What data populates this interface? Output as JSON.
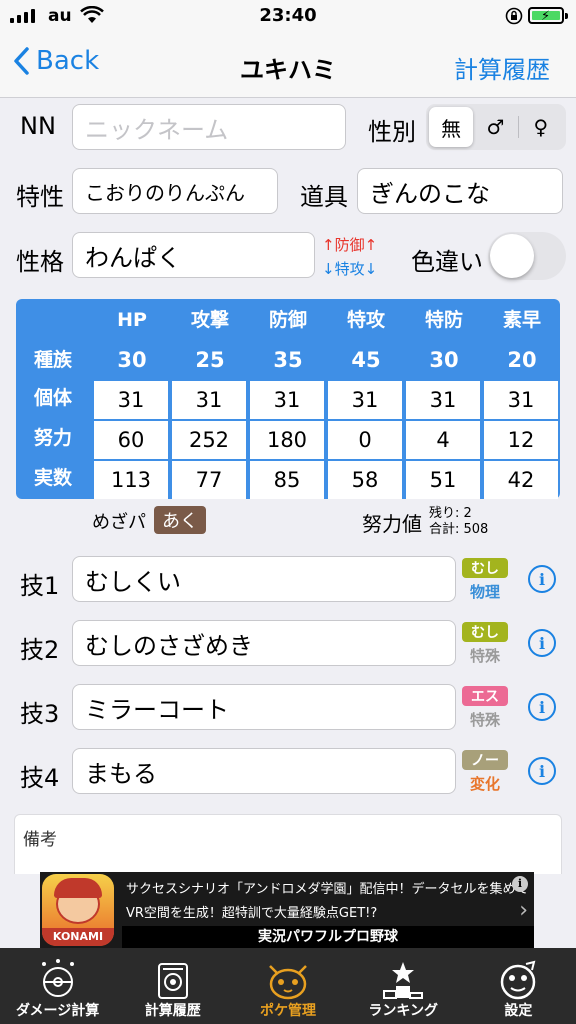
{
  "status": {
    "carrier": "au",
    "time": "23:40"
  },
  "nav": {
    "back": "Back",
    "title": "ユキハミ",
    "history": "計算履歴"
  },
  "form": {
    "nn_label": "NN",
    "nn_placeholder": "ニックネーム",
    "gender_label": "性別",
    "gender_options": [
      "無",
      "♂",
      "♀"
    ],
    "gender_selected": "無",
    "ability_label": "特性",
    "ability": "こおりのりんぷん",
    "item_label": "道具",
    "item": "ぎんのこな",
    "nature_label": "性格",
    "nature": "わんぱく",
    "nature_up": "↑防御↑",
    "nature_down": "↓特攻↓",
    "shiny_label": "色違い",
    "shiny": false
  },
  "stats": {
    "headers": [
      "HP",
      "攻撃",
      "防御",
      "特攻",
      "特防",
      "素早"
    ],
    "row_labels": [
      "種族",
      "個体",
      "努力",
      "実数"
    ],
    "base": [
      "30",
      "25",
      "35",
      "45",
      "30",
      "20"
    ],
    "iv": [
      "31",
      "31",
      "31",
      "31",
      "31",
      "31"
    ],
    "ev": [
      "60",
      "252",
      "180",
      "0",
      "4",
      "12"
    ],
    "actual": [
      "113",
      "77",
      "85",
      "58",
      "51",
      "42"
    ]
  },
  "hidden_power": {
    "label": "めざパ",
    "type": "あく"
  },
  "ev_summary": {
    "label": "努力値",
    "remaining": "残り: 2",
    "total": "合計: 508"
  },
  "moves": [
    {
      "label": "技1",
      "name": "むしくい",
      "type": "むし",
      "type_color": "#a3b41e",
      "category": "物理",
      "category_color": "#3a8fd8"
    },
    {
      "label": "技2",
      "name": "むしのさざめき",
      "type": "むし",
      "type_color": "#a3b41e",
      "category": "特殊",
      "category_color": "#9a9a9a"
    },
    {
      "label": "技3",
      "name": "ミラーコート",
      "type": "エス",
      "type_color": "#ec6a94",
      "category": "特殊",
      "category_color": "#9a9a9a"
    },
    {
      "label": "技4",
      "name": "まもる",
      "type": "ノー",
      "type_color": "#a8a07a",
      "category": "変化",
      "category_color": "#e8762c"
    }
  ],
  "memo": {
    "label": "備考"
  },
  "ad": {
    "line1": "サクセスシナリオ「アンドロメダ学園」配信中！データセルを集めて",
    "line2": "VR空間を生成！超特訓で大量経験点GET!?",
    "subtitle": "実況パワフルプロ野球",
    "brand": "KONAMI"
  },
  "tabs": [
    {
      "label": "ダメージ計算",
      "icon": "damage-calc-icon"
    },
    {
      "label": "計算履歴",
      "icon": "calc-history-icon"
    },
    {
      "label": "ポケ管理",
      "icon": "poke-manage-icon",
      "active": true
    },
    {
      "label": "ランキング",
      "icon": "ranking-icon"
    },
    {
      "label": "設定",
      "icon": "settings-icon"
    }
  ]
}
